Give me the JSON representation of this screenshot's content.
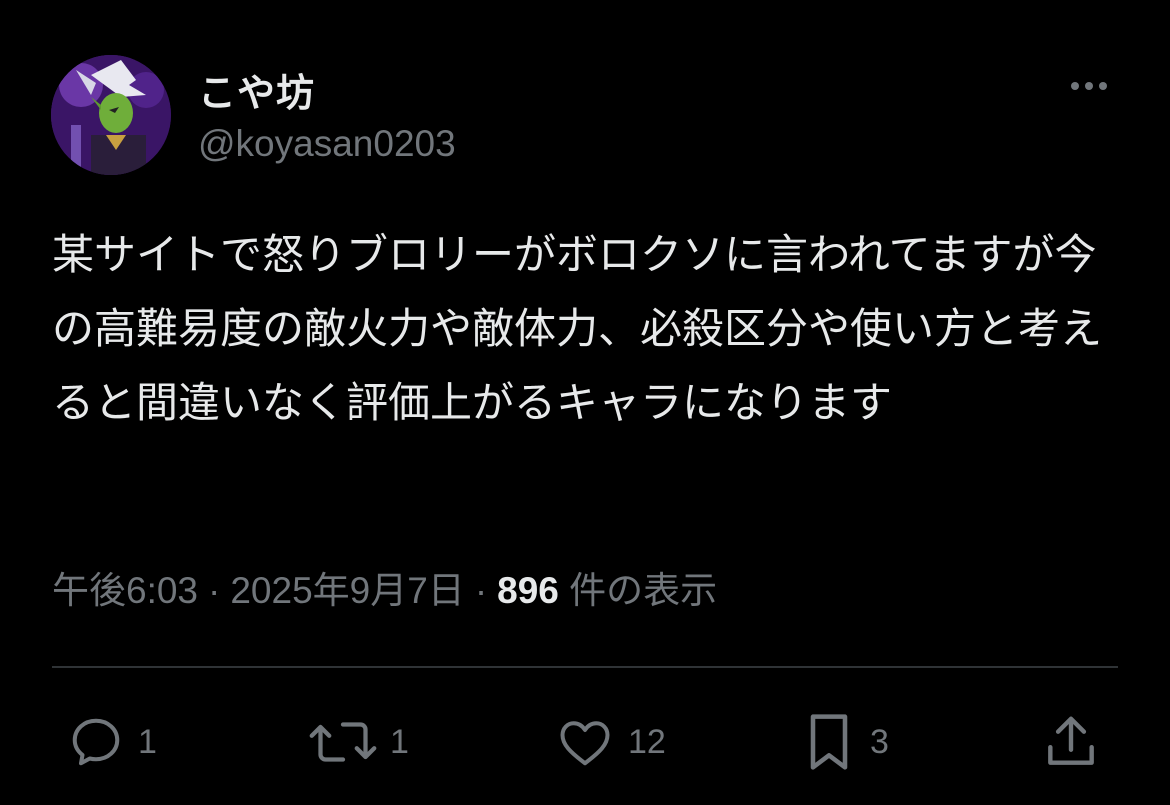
{
  "user": {
    "display_name": "こや坊",
    "handle": "@koyasan0203"
  },
  "tweet": {
    "text": "某サイトで怒りブロリーがボロクソに言われてますが今の高難易度の敵火力や敵体力、必殺区分や使い方と考えると間違いなく評価上がるキャラになります"
  },
  "meta": {
    "time": "午後6:03",
    "separator": "·",
    "date": "2025年9月7日",
    "views_count": "896",
    "views_label": "件の表示"
  },
  "actions": {
    "reply_count": "1",
    "retweet_count": "1",
    "like_count": "12",
    "bookmark_count": "3"
  },
  "icons": {
    "more": "more-horizontal-icon",
    "reply": "reply-icon",
    "retweet": "retweet-icon",
    "like": "heart-icon",
    "bookmark": "bookmark-icon",
    "share": "share-icon"
  },
  "colors": {
    "background": "#000000",
    "primary_text": "#e7e9ea",
    "secondary_text": "#71767b",
    "divider": "#2f3336"
  }
}
